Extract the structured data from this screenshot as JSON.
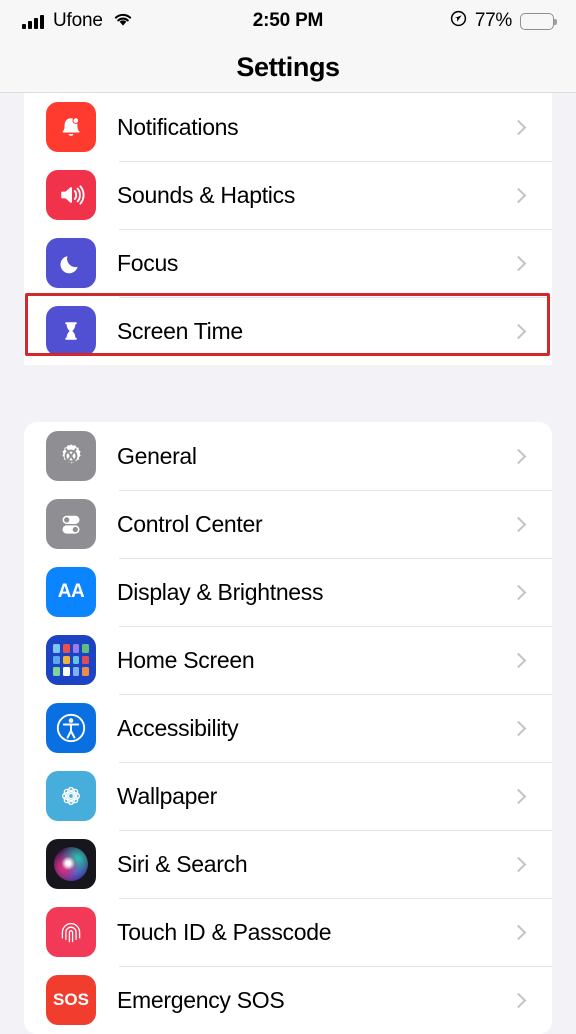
{
  "status_bar": {
    "signal_icon": "cellular-signal-icon",
    "carrier": "Ufone",
    "wifi_icon": "wifi-icon",
    "time": "2:50 PM",
    "location_icon": "location-arrow-icon",
    "battery_percent": "77%",
    "battery_icon": "battery-icon"
  },
  "nav": {
    "title": "Settings"
  },
  "sections": [
    {
      "name": "notifications-group",
      "rows": [
        {
          "label": "Notifications",
          "icon": "bell-icon",
          "color": "#FF3B30"
        },
        {
          "label": "Sounds & Haptics",
          "icon": "speaker-wave-icon",
          "color": "#F0324B"
        },
        {
          "label": "Focus",
          "icon": "moon-icon",
          "color": "#5150D3"
        },
        {
          "label": "Screen Time",
          "icon": "hourglass-icon",
          "color": "#5150D3",
          "highlighted": true
        }
      ]
    },
    {
      "name": "general-group",
      "rows": [
        {
          "label": "General",
          "icon": "gear-icon",
          "color": "#8E8E93"
        },
        {
          "label": "Control Center",
          "icon": "toggles-icon",
          "color": "#8E8E93"
        },
        {
          "label": "Display & Brightness",
          "icon": "text-size-aa-icon",
          "color": "#0A84FF"
        },
        {
          "label": "Home Screen",
          "icon": "app-grid-icon",
          "color": "#1B43C4"
        },
        {
          "label": "Accessibility",
          "icon": "accessibility-icon",
          "color": "#0A6FE0"
        },
        {
          "label": "Wallpaper",
          "icon": "flower-icon",
          "color": "#47AEDC"
        },
        {
          "label": "Siri & Search",
          "icon": "siri-orb-icon",
          "color": "#1A1A22"
        },
        {
          "label": "Touch ID & Passcode",
          "icon": "fingerprint-icon",
          "color": "#F23A58"
        },
        {
          "label": "Emergency SOS",
          "icon": "sos-icon",
          "color": "#F03D2E"
        }
      ]
    }
  ],
  "chevron_icon": "chevron-right-icon",
  "highlight": {
    "target": "Screen Time",
    "color": "#D5282B"
  },
  "palette": {
    "background": "#F2F2F7",
    "card": "#FFFFFF",
    "separator": "#E4E4E6",
    "chevron": "#C3C3C7",
    "text": "#000000"
  }
}
